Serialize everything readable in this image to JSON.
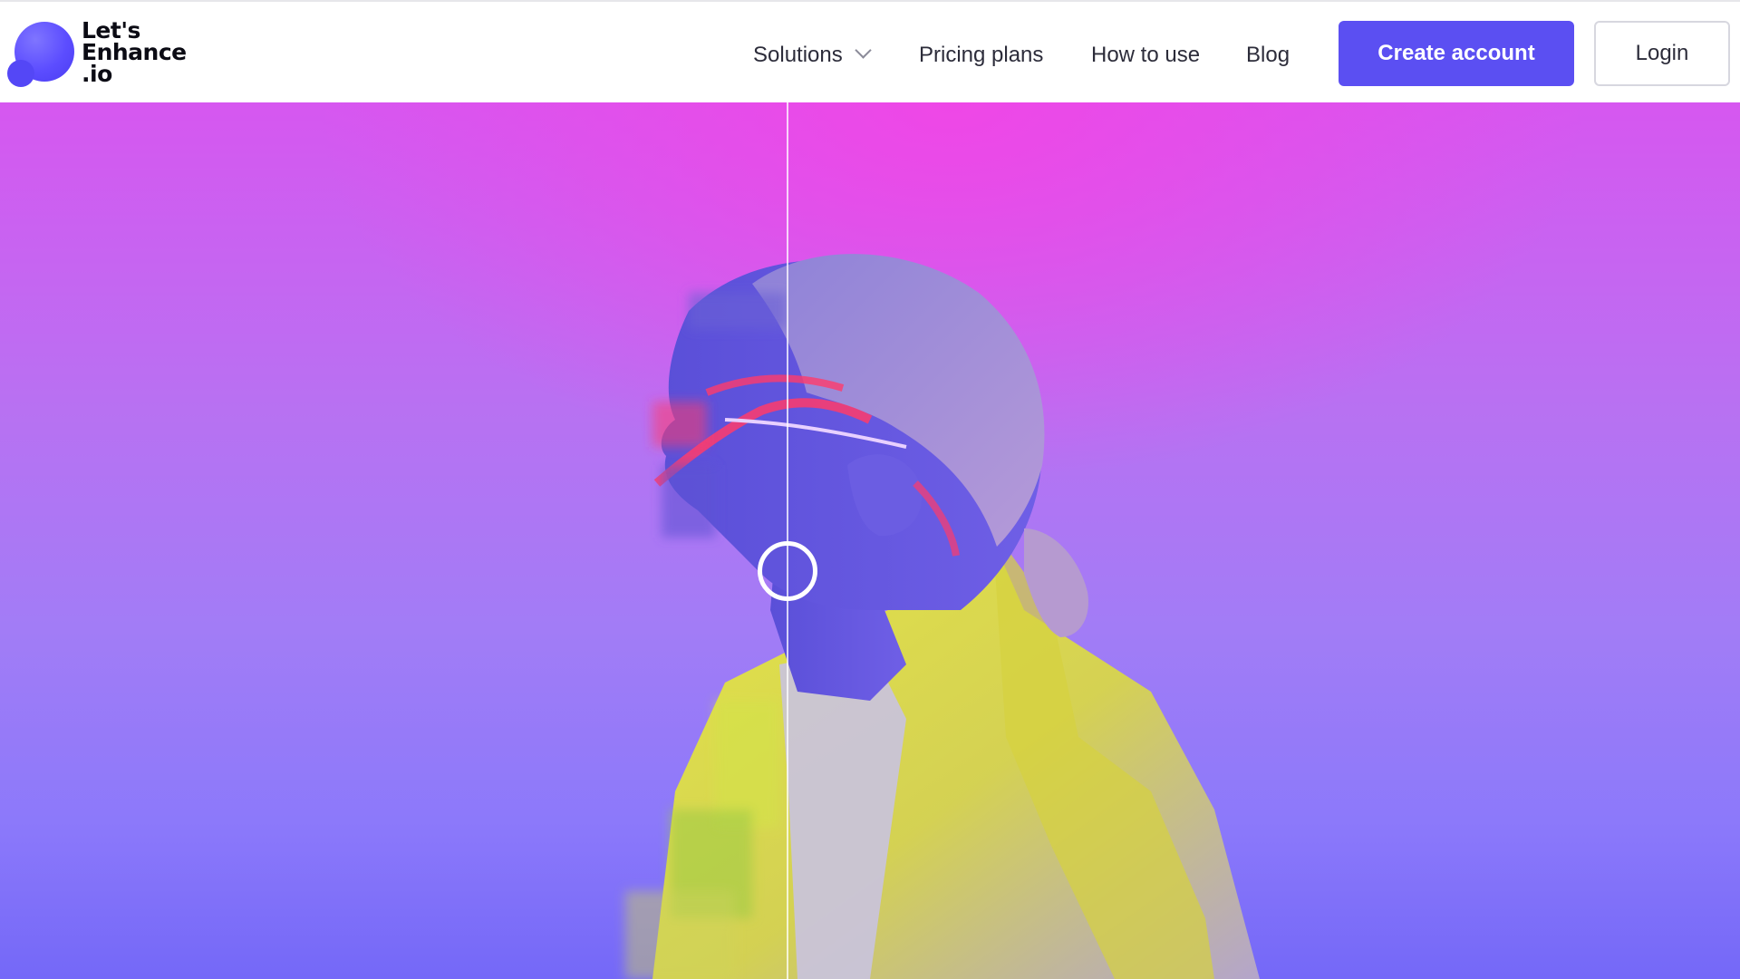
{
  "header": {
    "logo": {
      "line1": "Let's",
      "line2": "Enhance",
      "line3": ".io"
    },
    "nav": {
      "solutions": "Solutions",
      "pricing": "Pricing plans",
      "how_to_use": "How to use",
      "blog": "Blog"
    },
    "buttons": {
      "create_account": "Create account",
      "login": "Login"
    }
  },
  "hero": {
    "comparison_slider_position": 0.45
  },
  "colors": {
    "brand_primary": "#5b4ff2",
    "logo_purple": "#5c4dff",
    "hero_top": "#d657f0",
    "hero_bottom": "#7468f8"
  },
  "icons": {
    "solutions_dropdown": "chevron-down-icon",
    "slider_handle": "circle-handle-icon"
  }
}
